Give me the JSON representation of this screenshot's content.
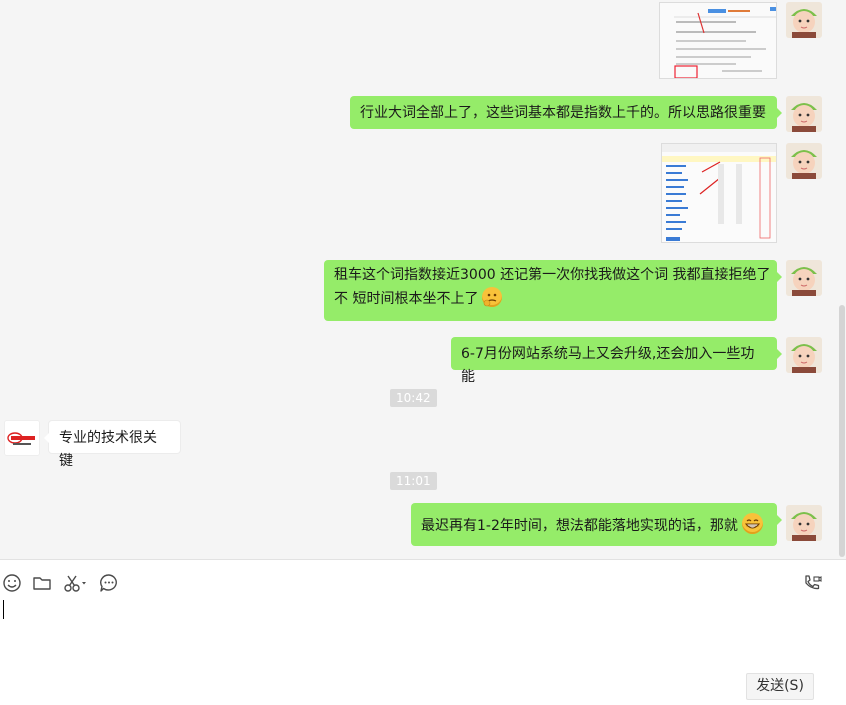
{
  "chat": {
    "messages": [
      {
        "type": "image",
        "from": "me"
      },
      {
        "type": "text",
        "from": "me",
        "text": "行业大词全部上了，这些词基本都是指数上千的。所以思路很重要"
      },
      {
        "type": "image",
        "from": "me"
      },
      {
        "type": "text",
        "from": "me",
        "line1": "租车这个词指数接近3000 还记第一次你找我做这个词 我都直接拒绝了",
        "line2": "不 短时间根本坐不上了",
        "emoji": "thinking-emoji"
      },
      {
        "type": "text",
        "from": "me",
        "text": "6-7月份网站系统马上又会升级,还会加入一些功能"
      },
      {
        "type": "time",
        "text": "10:42"
      },
      {
        "type": "text",
        "from": "other",
        "text": "专业的技术很关键"
      },
      {
        "type": "time",
        "text": "11:01"
      },
      {
        "type": "text",
        "from": "me",
        "text": "最迟再有1-2年时间，想法都能落地实现的话，那就",
        "emoji": "grin-emoji"
      }
    ]
  },
  "toolbar": {
    "icons": [
      "smiley-icon",
      "folder-icon",
      "scissors-icon",
      "chat-history-icon",
      "video-call-icon"
    ]
  },
  "input": {
    "value": "",
    "send_label": "发送(S)"
  },
  "colors": {
    "my_bubble": "#95ec69",
    "other_bubble": "#ffffff",
    "chat_bg": "#f5f5f5"
  }
}
